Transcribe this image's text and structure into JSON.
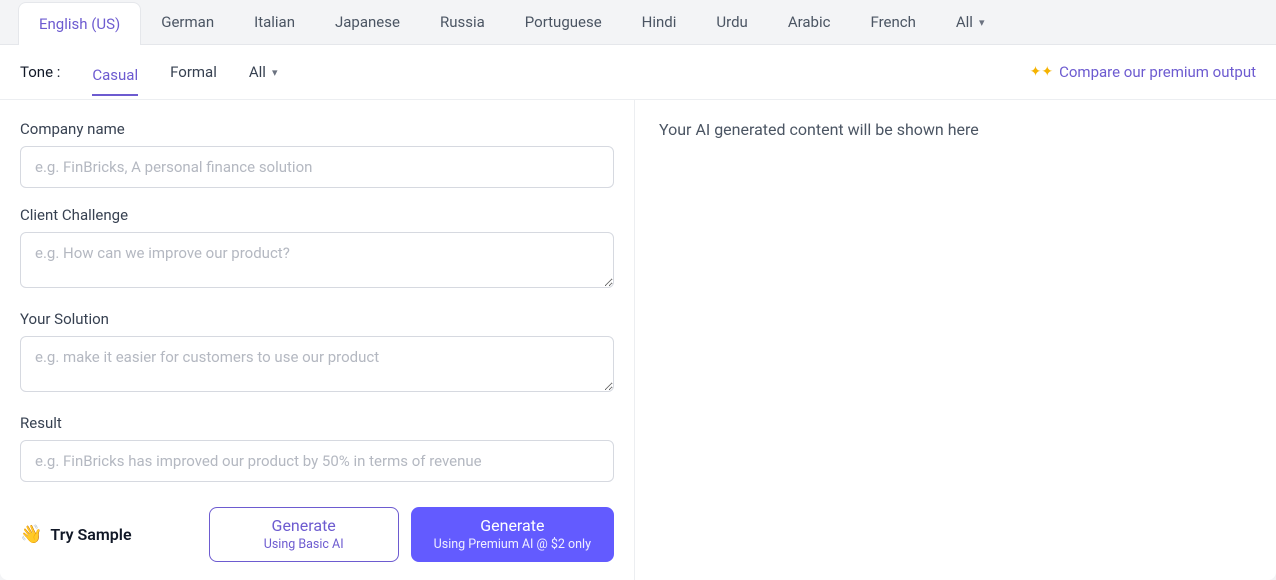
{
  "languages": {
    "items": [
      "English (US)",
      "German",
      "Italian",
      "Japanese",
      "Russia",
      "Portuguese",
      "Hindi",
      "Urdu",
      "Arabic",
      "French"
    ],
    "all_label": "All",
    "active_index": 0
  },
  "tone": {
    "label": "Tone :",
    "options": {
      "casual": "Casual",
      "formal": "Formal",
      "all": "All"
    },
    "active": "casual"
  },
  "premium_link": "Compare our premium output",
  "fields": {
    "company": {
      "label": "Company name",
      "placeholder": "e.g. FinBricks, A personal finance solution",
      "value": ""
    },
    "challenge": {
      "label": "Client Challenge",
      "placeholder": "e.g. How can we improve our product?",
      "value": ""
    },
    "solution": {
      "label": "Your Solution",
      "placeholder": "e.g. make it easier for customers to use our product",
      "value": ""
    },
    "result": {
      "label": "Result",
      "placeholder": "e.g. FinBricks has improved our product by 50% in terms of revenue",
      "value": ""
    }
  },
  "actions": {
    "try_sample": "Try Sample",
    "generate_basic": {
      "title": "Generate",
      "sub": "Using Basic AI"
    },
    "generate_premium": {
      "title": "Generate",
      "sub": "Using Premium AI @ $2 only"
    }
  },
  "output_placeholder": "Your AI generated content will be shown here"
}
